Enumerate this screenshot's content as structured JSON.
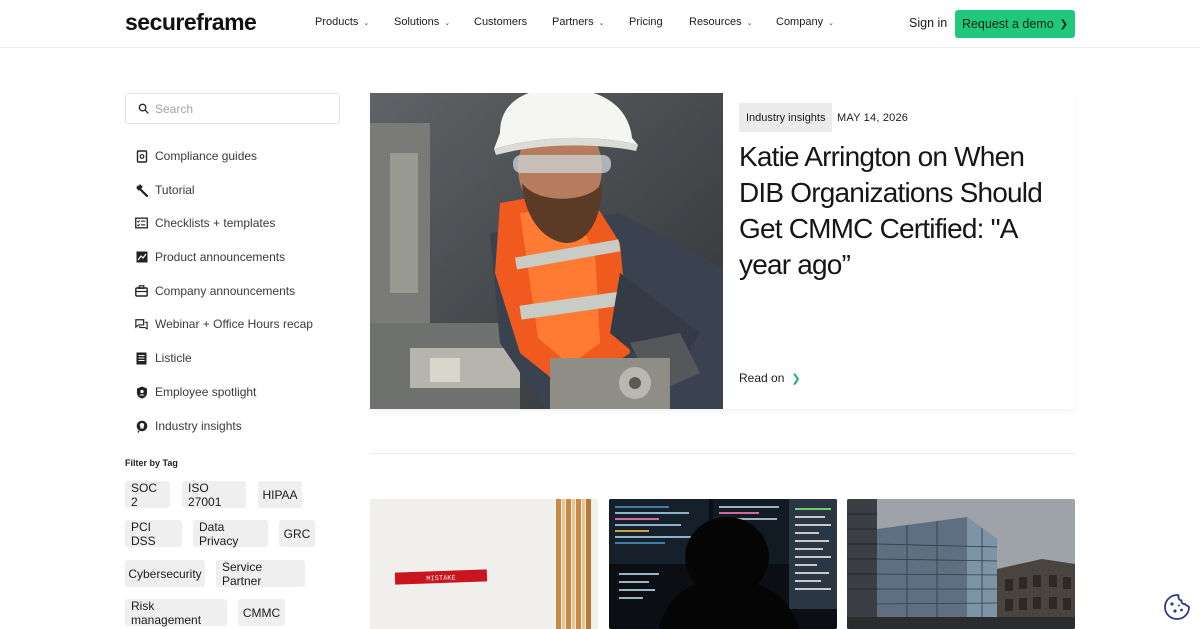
{
  "brand": {
    "logo_text": "secureframe",
    "accent": "#1fc87a"
  },
  "nav": {
    "items": [
      {
        "label": "Products",
        "dropdown": true
      },
      {
        "label": "Solutions",
        "dropdown": true
      },
      {
        "label": "Customers",
        "dropdown": false
      },
      {
        "label": "Partners",
        "dropdown": true
      },
      {
        "label": "Pricing",
        "dropdown": false
      },
      {
        "label": "Resources",
        "dropdown": true
      },
      {
        "label": "Company",
        "dropdown": true
      }
    ],
    "signin_label": "Sign in",
    "demo_label": "Request a demo"
  },
  "sidebar": {
    "search_placeholder": "Search",
    "categories": [
      {
        "label": "Compliance guides",
        "icon": "guide-icon"
      },
      {
        "label": "Tutorial",
        "icon": "wrench-icon"
      },
      {
        "label": "Checklists + templates",
        "icon": "checklist-icon"
      },
      {
        "label": "Product announcements",
        "icon": "chart-icon"
      },
      {
        "label": "Company announcements",
        "icon": "briefcase-icon"
      },
      {
        "label": "Webinar + Office Hours recap",
        "icon": "chat-icon"
      },
      {
        "label": "Listicle",
        "icon": "list-doc-icon"
      },
      {
        "label": "Employee spotlight",
        "icon": "badge-icon"
      },
      {
        "label": "Industry insights",
        "icon": "lightbulb-icon"
      }
    ],
    "filter_title": "Filter by Tag",
    "tags": [
      "SOC 2",
      "ISO 27001",
      "HIPAA",
      "PCI DSS",
      "Data Privacy",
      "GRC",
      "Cybersecurity",
      "Service Partner",
      "Risk management",
      "CMMC"
    ]
  },
  "featured": {
    "category": "Industry insights",
    "date": "MAY 14, 2026",
    "title": "Katie Arrington on When DIB Organizations Should Get CMMC Certified: \"A year ago”",
    "read_label": "Read on"
  },
  "cards": [
    {
      "image": "mistake-label-photo",
      "label_text": "MISTAKE"
    },
    {
      "image": "hacker-monitors-photo"
    },
    {
      "image": "glass-office-building-photo"
    }
  ]
}
